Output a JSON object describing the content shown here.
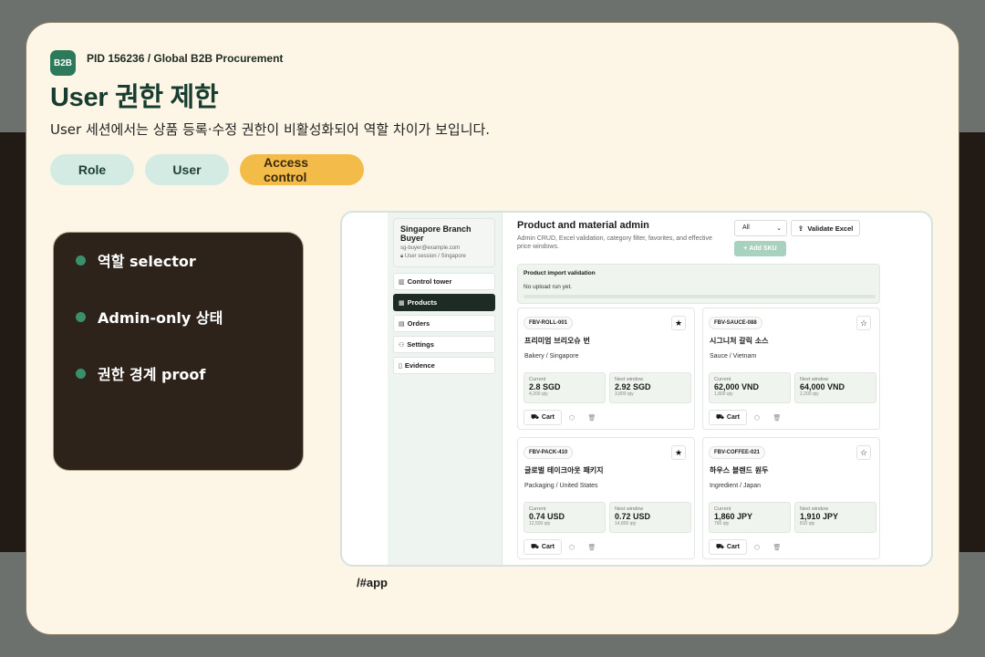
{
  "header": {
    "logo": "B2B",
    "pid": "PID 156236 / Global B2B Procurement",
    "title": "User 권한 제한",
    "subtitle": "User 세션에서는 상품 등록·수정 권한이 비활성화되어 역할 차이가 보입니다."
  },
  "pills": [
    "Role",
    "User",
    "Access control"
  ],
  "features": [
    "역할 selector",
    "Admin-only 상태",
    "권한 경계 proof"
  ],
  "url": "/#app",
  "app": {
    "user": {
      "name": "Singapore Branch Buyer",
      "email": "sg-buyer@example.com",
      "session": "User session / Singapore"
    },
    "nav": [
      "Control tower",
      "Products",
      "Orders",
      "Settings",
      "Evidence"
    ],
    "active_nav": "Products",
    "main": {
      "title": "Product and material admin",
      "description": "Admin CRUD, Excel validation, category filter, favorites, and effective price windows.",
      "filter_value": "All",
      "validate_label": "Validate Excel",
      "add_sku_label": "Add SKU",
      "validation_title": "Product import validation",
      "validation_status": "No upload run yet."
    },
    "products": [
      {
        "sku": "FBV-ROLL-001",
        "name": "프리미엄 브리오슈 번",
        "category": "Bakery / Singapore",
        "current_label": "Current",
        "current": "2.8 SGD",
        "current_qty": "4,200 qty",
        "next_label": "Next window",
        "next": "2.92 SGD",
        "next_qty": "3,800 qty",
        "favorite": true
      },
      {
        "sku": "FBV-SAUCE-088",
        "name": "시그니처 갈릭 소스",
        "category": "Sauce / Vietnam",
        "current_label": "Current",
        "current": "62,000 VND",
        "current_qty": "1,800 qty",
        "next_label": "Next window",
        "next": "64,000 VND",
        "next_qty": "2,200 qty",
        "favorite": false
      },
      {
        "sku": "FBV-PACK-410",
        "name": "글로벌 테이크아웃 패키지",
        "category": "Packaging / United States",
        "current_label": "Current",
        "current": "0.74 USD",
        "current_qty": "12,500 qty",
        "next_label": "Next window",
        "next": "0.72 USD",
        "next_qty": "14,800 qty",
        "favorite": true
      },
      {
        "sku": "FBV-COFFEE-021",
        "name": "하우스 블렌드 원두",
        "category": "Ingredient / Japan",
        "current_label": "Current",
        "current": "1,860 JPY",
        "current_qty": "760 qty",
        "next_label": "Next window",
        "next": "1,910 JPY",
        "next_qty": "810 qty",
        "favorite": false
      }
    ],
    "cart_label": "Cart"
  },
  "colors": {
    "accent": "#2d7a5a",
    "highlight": "#f3bc48",
    "pill": "#d3ebe2",
    "dark_panel": "#2d231a"
  }
}
